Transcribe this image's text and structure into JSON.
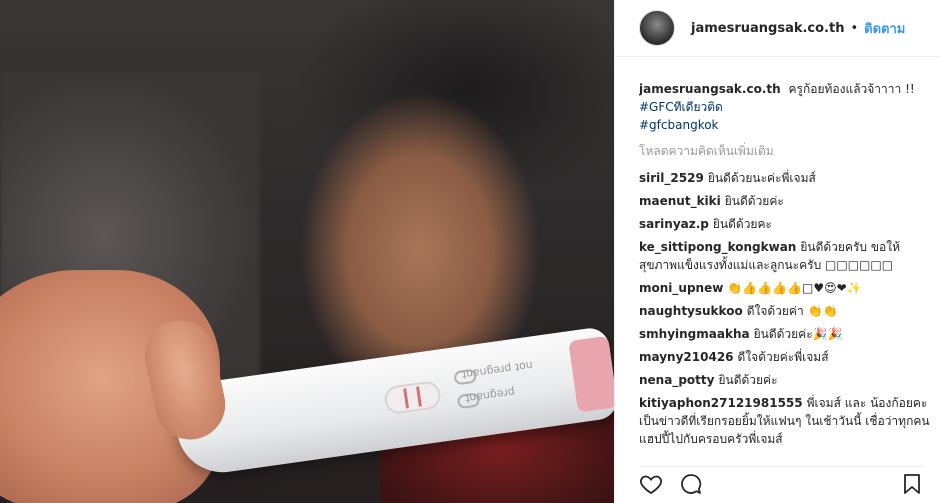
{
  "post": {
    "username": "jamesruangsak.co.th",
    "follow_label": "ติดตาม",
    "separator": "•"
  },
  "caption": {
    "username": "jamesruangsak.co.th",
    "text": "ครูก้อยท้องแล้วจ้าาาา !!",
    "hashtags": [
      "#GFCทีเดียวติด",
      "#gfcbangkok"
    ]
  },
  "load_more": "โหลดความคิดเห็นเพิ่มเติม",
  "comments": [
    {
      "user": "siril_2529",
      "text": "ยินดีด้วยนะค่ะพี่เจมส์"
    },
    {
      "user": "maenut_kiki",
      "text": "ยินดีด้วยค่ะ"
    },
    {
      "user": "sarinyaz.p",
      "text": "ยินดีด้วยคะ"
    },
    {
      "user": "ke_sittipong_kongkwan",
      "text": "ยินดีด้วยครับ ขอให้สุขภาพแข็งแรงทั้งแม่และลูกนะครับ □□□□□□"
    },
    {
      "user": "moni_upnew",
      "text": "👏👍👍👍👍□♥😍❤✨"
    },
    {
      "user": "naughtysukkoo",
      "text": "ดีใจด้วยค่า 👏👏"
    },
    {
      "user": "smhyingmaakha",
      "text": "ยินดีด้วยค่ะ🎉🎉"
    },
    {
      "user": "mayny210426",
      "text": "ดีใจด้วยค่ะพี่เจมส์"
    },
    {
      "user": "nena_potty",
      "text": "ยินดีด้วยค่ะ"
    },
    {
      "user": "kitiyaphon27121981555",
      "text": "พี่เจมส์ และ น้องก้อยคะ เป็นข่าวดีที่เรียกรอยยิ้มให้แฟนๆ ในเช้าวันนี้ เชื่อว่าทุกคนแฮปปี้ไปกับครอบครัวพี่เจมส์"
    }
  ],
  "icons": [
    "heart-icon",
    "comment-icon",
    "bookmark-icon"
  ],
  "photo": {
    "test_text_1": "not pregnant",
    "test_text_2": "pregnant"
  }
}
